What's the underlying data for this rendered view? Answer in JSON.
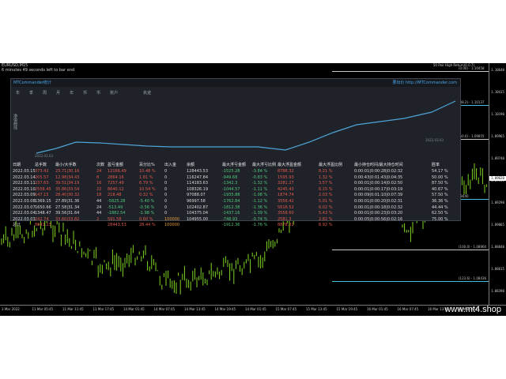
{
  "app": {
    "title_left": "EURUSD,M15",
    "title_left_line2": "6 minutes 49 seconds left to bar end",
    "title_right": "50 Pair High Return(0.0.7)"
  },
  "colors": {
    "panel_bg": "#1f2329",
    "accent_blue": "#4aa3e8",
    "equity_line": "#4fa3d6",
    "profit_green": "#52c77a",
    "loss_red": "#e05a4e",
    "candle_green": "#7ed321",
    "level_cyan": "#3fbfd8",
    "level_white": "#c8c8c8"
  },
  "panel": {
    "title": "MTCommander统计",
    "link": "要出价 http://MTCommander.com",
    "toolbar": [
      "年",
      "季",
      "周",
      "月",
      "年",
      "币",
      "币",
      "账户",
      "执迹"
    ],
    "equity_side_label": "净值曲线",
    "equity_date_left": "2022.03.03",
    "equity_date_right": "2022.03.03"
  },
  "table": {
    "headers": [
      "日期",
      "总手数",
      "最小/大手数",
      "次数",
      "盈亏金额",
      "百分比%",
      "出入金",
      "余额",
      "最大浮亏金额",
      "最大浮亏比例",
      "最大浮盈金额",
      "最大浮盈比例",
      "最小持仓时间/最大持仓时间",
      "胜率"
    ],
    "rows": [
      {
        "cells": [
          "2022.03.15",
          "373.42",
          "23.71|30.16",
          "24",
          "12166.49",
          "10.48 %",
          "0",
          "128443.53",
          "-1525.28",
          "-3.84 %",
          "8788.32",
          "8.21 %",
          "0:00:01|0:00:28|0:02:32",
          "54.17 %"
        ],
        "tone": [
          "white",
          "red",
          "red",
          "red",
          "red",
          "red",
          "white",
          "white",
          "green",
          "green",
          "red",
          "red",
          "white",
          "white"
        ]
      },
      {
        "cells": [
          "2022.03.14",
          "205.57",
          "12.98|34.43",
          "8",
          "2864.16",
          "1.81 %",
          "0",
          "116247.84",
          "-949.68",
          "-0.83 %",
          "1595.93",
          "1.32 %",
          "0:00:43|0:01:43|0:04:35",
          "50.00 %"
        ],
        "tone": [
          "white",
          "red",
          "red",
          "red",
          "red",
          "red",
          "white",
          "white",
          "green",
          "green",
          "red",
          "red",
          "white",
          "white"
        ]
      },
      {
        "cells": [
          "2022.03.11",
          "237.63",
          "39.51|34.19",
          "16",
          "7257.49",
          "6.79 %",
          "0",
          "114183.63",
          "-1342.3",
          "-1.32 %",
          "3281.27",
          "3.57 %",
          "0:00:01|0:00:14|0:02:50",
          "87.50 %"
        ],
        "tone": [
          "white",
          "red",
          "red",
          "red",
          "red",
          "red",
          "white",
          "white",
          "green",
          "green",
          "red",
          "red",
          "white",
          "white"
        ]
      },
      {
        "cells": [
          "2022.03.10",
          "2558.45",
          "35.86|33.54",
          "22",
          "8640.12",
          "10.54 %",
          "0",
          "108326.19",
          "-1044.57",
          "-1.11 %",
          "4245.43",
          "6.15 %",
          "0:00:01|0:00:17|0:03:19",
          "40.67 %"
        ],
        "tone": [
          "white",
          "red",
          "red",
          "red",
          "red",
          "red",
          "white",
          "white",
          "green",
          "green",
          "red",
          "red",
          "white",
          "white"
        ]
      },
      {
        "cells": [
          "2022.03.09",
          "147.15",
          "28.40|30.32",
          "18",
          "218.48",
          "0.32 %",
          "0",
          "97088.07",
          "-1935.88",
          "-1.08 %",
          "1874.74",
          "2.03 %",
          "0:00:09|0:01:10|0:07:39",
          "57.50 %"
        ],
        "tone": [
          "white",
          "red",
          "red",
          "red",
          "red",
          "red",
          "white",
          "white",
          "green",
          "green",
          "red",
          "red",
          "white",
          "white"
        ]
      },
      {
        "cells": [
          "2022.03.08",
          "1369.15",
          "27.89|31.36",
          "44",
          "-5825.28",
          "-5.40 %",
          "0",
          "96997.58",
          "-1762.84",
          "-1.12 %",
          "3556.42",
          "5.01 %",
          "0:00:01|0:00:20|0:02:31",
          "36.36 %"
        ],
        "tone": [
          "white",
          "white",
          "white",
          "white",
          "green",
          "green",
          "white",
          "white",
          "green",
          "green",
          "red",
          "red",
          "white",
          "white"
        ]
      },
      {
        "cells": [
          "2022.03.07",
          "1650.66",
          "27.58|31.34",
          "24",
          "-513.49",
          "-0.56 %",
          "0",
          "102402.87",
          "-1812.38",
          "-1.36 %",
          "5616.52",
          "6.02 %",
          "0:00:01|0:00:18|0:02:32",
          "44.44 %"
        ],
        "tone": [
          "white",
          "white",
          "white",
          "white",
          "green",
          "green",
          "white",
          "white",
          "green",
          "green",
          "red",
          "red",
          "white",
          "white"
        ]
      },
      {
        "cells": [
          "2022.03.04",
          "1348.47",
          "39.56|31.64",
          "44",
          "-1882.54",
          "-1.98 %",
          "0",
          "104375.04",
          "-1437.16",
          "-1.39 %",
          "3558.60",
          "5.43 %",
          "0:00:01|0:00:23|0:03:20",
          "62.50 %"
        ],
        "tone": [
          "white",
          "white",
          "white",
          "white",
          "green",
          "green",
          "white",
          "white",
          "green",
          "green",
          "red",
          "red",
          "white",
          "white"
        ]
      },
      {
        "cells": [
          "2022.03.03",
          "242.74",
          "33.60|33.82",
          "2",
          "591.58",
          "0.60 %",
          "100000",
          "104955.00",
          "-748.93",
          "-0.74 %",
          "2581.3",
          "2.82 %",
          "0:00:05|0:00:56|0:02:16",
          "75.00 %"
        ],
        "tone": [
          "white",
          "red",
          "red",
          "red",
          "red",
          "red",
          "orange",
          "white",
          "green",
          "green",
          "red",
          "red",
          "white",
          "white"
        ]
      },
      {
        "cells": [
          "总计",
          "8841.23",
          "",
          "",
          "28443.53",
          "28.44 %",
          "100000",
          "",
          "-1912.36",
          "-1.76 %",
          "8878.22",
          "8.92 %",
          "",
          ""
        ],
        "tone": [
          "white",
          "red",
          "red",
          "red",
          "red",
          "red",
          "orange",
          "white",
          "green",
          "green",
          "red",
          "red",
          "white",
          "white"
        ]
      }
    ]
  },
  "chart": {
    "prices": [
      "1.10640",
      "1.10415",
      "1.10190",
      "1.09965",
      "1.09740",
      "1.09515",
      "1.09290",
      "1.09065",
      "1.08840",
      "1.08615",
      "1.08390"
    ],
    "current_price": "1.09620",
    "levels": [
      {
        "tag": "(0.00) - 1.10458",
        "color": "#c8c8c8"
      },
      {
        "tag": "(38.2) - 1.10137",
        "color": "#3fbfd8"
      },
      {
        "tag": "(50.0) - 1.09855",
        "color": "#c8c8c8"
      },
      {
        "tag": "(61.8) - 1.09440",
        "color": "#3fbfd8"
      },
      {
        "tag": "(100.0) - 1.08960",
        "color": "#c8c8c8"
      },
      {
        "tag": "(123.6) - 1.08436",
        "color": "#3fbfd8"
      }
    ],
    "dates": [
      "3 Mar 2022",
      "11 Mar 05:45",
      "11 Mar 11:45",
      "11 Mar 17:45",
      "14 Mar 01:45",
      "14 Mar 07:45",
      "14 Mar 13:45",
      "14 Mar 19:45",
      "14 Mar 01:45",
      "15 Mar 07:45",
      "15 Mar 13:45",
      "15 Mar 19:45",
      "16 Mar 01:45",
      "16 Mar 07:45",
      "16 Mar 13:45",
      "16 Mar 19:45"
    ],
    "watermark": "www.mt4.shop"
  }
}
